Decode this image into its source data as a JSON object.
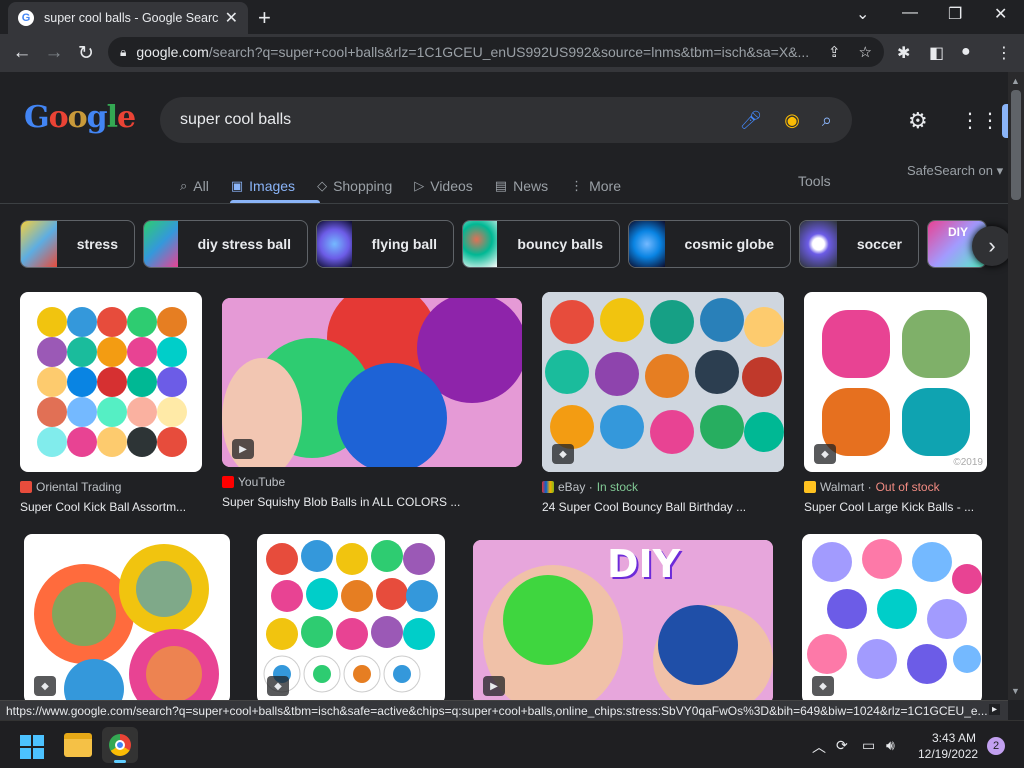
{
  "browser": {
    "tab_title": "super cool balls - Google Search",
    "tab_close": "✕",
    "new_tab": "+",
    "window_controls": [
      "⌄",
      "—",
      "❐",
      "✕"
    ],
    "url_domain": "google.com",
    "url_rest": "/search?q=super+cool+balls&rlz=1C1GCEU_enUS992US992&source=lnms&tbm=isch&sa=X&...",
    "back": "←",
    "forward": "→",
    "reload": "↻"
  },
  "google": {
    "logo": [
      "G",
      "o",
      "o",
      "g",
      "l",
      "e"
    ],
    "query": "super cool balls",
    "tabs": [
      {
        "icon": "⌕",
        "label": "All"
      },
      {
        "icon": "▣",
        "label": "Images"
      },
      {
        "icon": "◇",
        "label": "Shopping"
      },
      {
        "icon": "▷",
        "label": "Videos"
      },
      {
        "icon": "▤",
        "label": "News"
      },
      {
        "icon": "⋮",
        "label": "More"
      }
    ],
    "tools": "Tools",
    "safesearch": "SafeSearch on ▾"
  },
  "chips": [
    {
      "label": "stress"
    },
    {
      "label": "diy stress ball"
    },
    {
      "label": "flying ball"
    },
    {
      "label": "bouncy balls"
    },
    {
      "label": "cosmic globe"
    },
    {
      "label": "soccer"
    },
    {
      "label": "DIY"
    }
  ],
  "results_row1": [
    {
      "source": "Oriental Trading",
      "status": "",
      "title": "Super Cool Kick Ball Assortm..."
    },
    {
      "source": "YouTube",
      "status": "",
      "title": "Super Squishy Blob Balls in ALL COLORS ..."
    },
    {
      "source": "eBay",
      "status": "In stock",
      "title": "24 Super Cool Bouncy Ball Birthday ..."
    },
    {
      "source": "Walmart",
      "status": "Out of stock",
      "title": "Super Cool Large Kick Balls - ..."
    }
  ],
  "row2_overlay_text": "DIY",
  "watermark": "©2019",
  "status_url": "https://www.google.com/search?q=super+cool+balls&tbm=isch&safe=active&chips=q:super+cool+balls,online_chips:stress:SbVY0qaFwOs%3D&bih=649&biw=1024&rlz=1C1GCEU_e...",
  "status_more": "▸",
  "taskbar": {
    "time": "3:43 AM",
    "date": "12/19/2022",
    "notifications": "2"
  },
  "colors": {
    "accent": "#8ab4f8",
    "background": "#202124",
    "in_stock": "#81c995",
    "out_of_stock": "#f28b82"
  }
}
